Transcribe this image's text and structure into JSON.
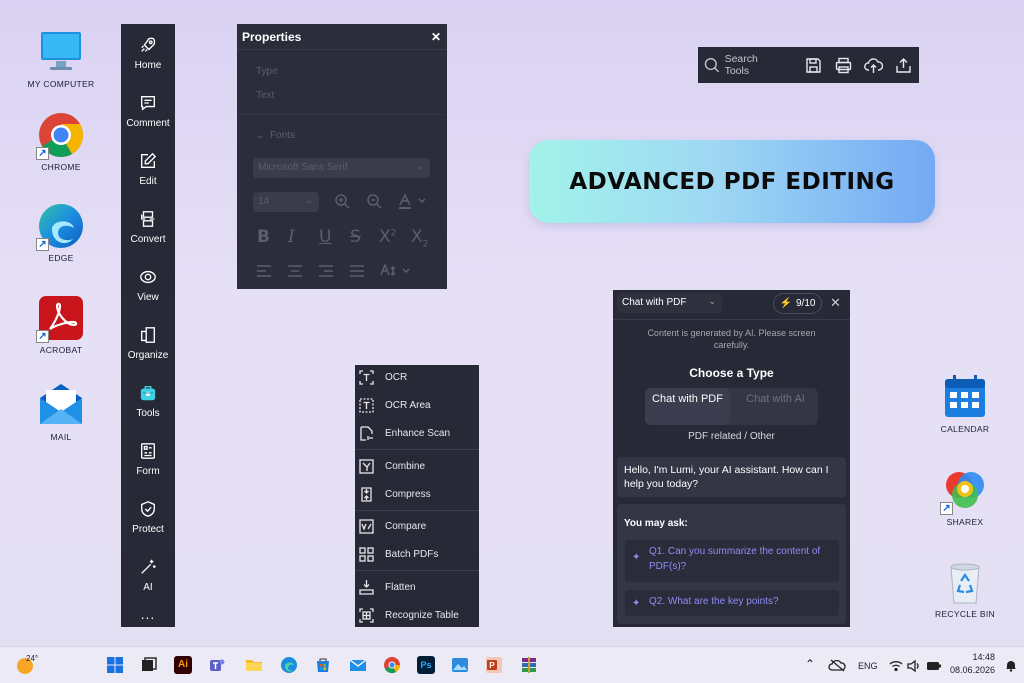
{
  "desktop": {
    "icons_left": [
      {
        "name": "my-computer",
        "label": "MY COMPUTER"
      },
      {
        "name": "chrome",
        "label": "CHROME"
      },
      {
        "name": "edge",
        "label": "EDGE"
      },
      {
        "name": "acrobat",
        "label": "ACROBAT"
      },
      {
        "name": "mail",
        "label": "MAIL"
      }
    ],
    "icons_right": [
      {
        "name": "calendar",
        "label": "CALENDAR"
      },
      {
        "name": "sharex",
        "label": "SHAREX"
      },
      {
        "name": "recycle-bin",
        "label": "RECYCLE BIN"
      }
    ]
  },
  "leftnav": {
    "items": [
      {
        "label": "Home",
        "icon": "rocket-icon"
      },
      {
        "label": "Comment",
        "icon": "comment-icon"
      },
      {
        "label": "Edit",
        "icon": "edit-icon"
      },
      {
        "label": "Convert",
        "icon": "convert-icon"
      },
      {
        "label": "View",
        "icon": "view-icon"
      },
      {
        "label": "Organize",
        "icon": "organize-icon"
      },
      {
        "label": "Tools",
        "icon": "tools-icon",
        "active": true
      },
      {
        "label": "Form",
        "icon": "form-icon"
      },
      {
        "label": "Protect",
        "icon": "shield-icon"
      },
      {
        "label": "AI",
        "icon": "ai-wand-icon"
      }
    ],
    "more": "..."
  },
  "properties": {
    "title": "Properties",
    "type_label": "Type",
    "text_label": "Text",
    "fonts_label": "Fonts",
    "font_value": "Microsoft Sans Serif",
    "size_value": "14"
  },
  "toolbar": {
    "search_placeholder": "Search Tools"
  },
  "banner": {
    "text": "ADVANCED PDF EDITING"
  },
  "tools_menu": {
    "items": [
      "OCR",
      "OCR Area",
      "Enhance Scan",
      "Combine",
      "Compress",
      "Compare",
      "Batch PDFs",
      "Flatten",
      "Recognize Table"
    ]
  },
  "chat": {
    "mode": "Chat with PDF",
    "counter": "9/10",
    "note": "Content is generated by AI. Please screen carefully.",
    "choose_title": "Choose a Type",
    "option_pdf": "Chat with PDF",
    "option_ai": "Chat with AI",
    "related": "PDF related / Other",
    "greeting": "Hello, I'm Lumi, your AI assistant. How can I help you today?",
    "may_ask": "You may ask:",
    "q1": "Q1. Can you summarize the content of PDF(s)?",
    "q2": "Q2. What are the key points?"
  },
  "taskbar": {
    "weather": "24°",
    "language": "ENG",
    "time": "14:48",
    "date": "08.06.2026"
  },
  "colors": {
    "panel": "#272936",
    "accent": "#8f8cf6",
    "banner_from": "#a2f3ea",
    "banner_to": "#74a9f4"
  }
}
